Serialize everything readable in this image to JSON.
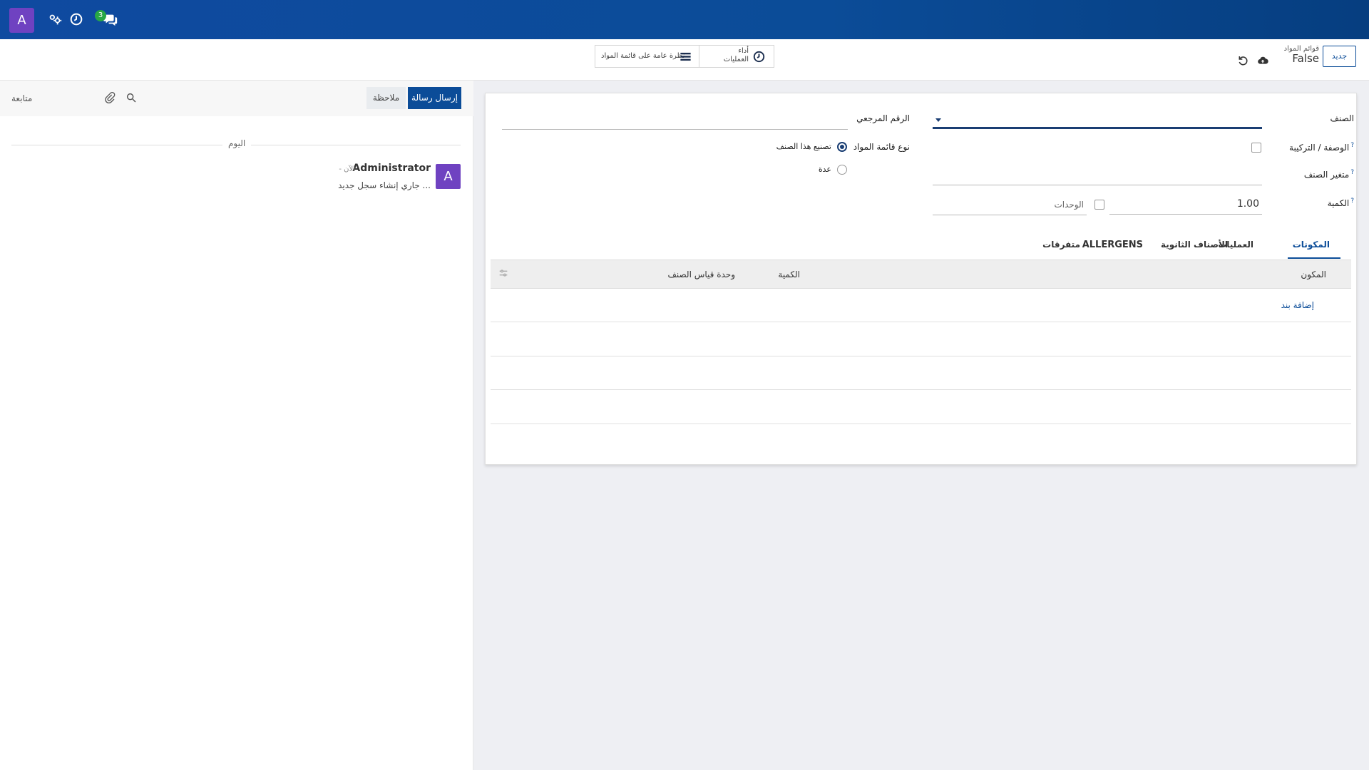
{
  "navbar": {
    "avatar_letter": "A",
    "chat_badge": "3",
    "icons": [
      "users-cog-icon",
      "clock-icon",
      "chat-bubbles-icon"
    ]
  },
  "control_panel": {
    "new_button": "جديد",
    "breadcrumb_parent": "قوائم المواد",
    "breadcrumb_current": "False",
    "smart_buttons": {
      "operations_line1": "أداء",
      "operations_line2": "العمليات",
      "overview_label": "نظرة عامة على قائمة المواد"
    }
  },
  "chatter": {
    "send_message": "إرسال رسالة",
    "log_note": "ملاحظة",
    "follow": "متابعة",
    "today": "اليوم",
    "message": {
      "avatar_letter": "A",
      "author": "Administrator",
      "time": "- الآن",
      "body": "جاري إنشاء سجل جديد ..."
    }
  },
  "form": {
    "product_label": "الصنف",
    "reference_label": "الرقم المرجعي",
    "recipe_label": "الوصفة / التركيبة",
    "bom_type_label": "نوع قائمة المواد",
    "bom_type_options": [
      "تصنيع هذا الصنف",
      "عدة"
    ],
    "variant_label": "متغير الصنف",
    "quantity_label": "الكمية",
    "quantity_value": "1.00",
    "uom_label": "الوحدات",
    "help_mark": "?"
  },
  "tabs": [
    "المكونات",
    "العمليات",
    "الأصناف الثانوية",
    "ALLERGENS",
    "متفرقات"
  ],
  "table": {
    "columns": [
      "المكون",
      "الكمية",
      "وحدة قياس الصنف"
    ],
    "add_line": "إضافة بند"
  }
}
